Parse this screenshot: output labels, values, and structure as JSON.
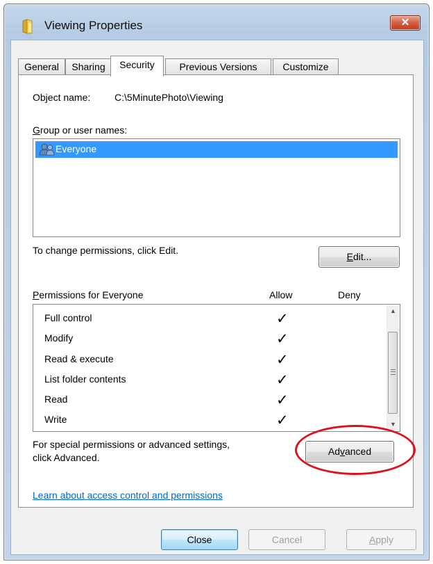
{
  "window": {
    "title": "Viewing Properties",
    "close_glyph": "✕"
  },
  "tabs": [
    {
      "label": "General",
      "active": false
    },
    {
      "label": "Sharing",
      "active": false
    },
    {
      "label": "Security",
      "active": true
    },
    {
      "label": "Previous Versions",
      "active": false
    },
    {
      "label": "Customize",
      "active": false
    }
  ],
  "security": {
    "object_name_label": "Object name:",
    "object_name_value": "C:\\5MinutePhoto\\Viewing",
    "group_label_prefix": "",
    "group_label_u": "G",
    "group_label_rest": "roup or user names:",
    "users": [
      {
        "name": "Everyone",
        "selected": true,
        "icon": "users-icon"
      }
    ],
    "change_hint": "To change permissions, click Edit.",
    "edit_u": "E",
    "edit_rest": "dit...",
    "permissions_u": "P",
    "permissions_rest": "ermissions for Everyone",
    "allow_header": "Allow",
    "deny_header": "Deny",
    "permissions": [
      {
        "name": "Full control",
        "allow": "✓",
        "deny": ""
      },
      {
        "name": "Modify",
        "allow": "✓",
        "deny": ""
      },
      {
        "name": "Read & execute",
        "allow": "✓",
        "deny": ""
      },
      {
        "name": "List folder contents",
        "allow": "✓",
        "deny": ""
      },
      {
        "name": "Read",
        "allow": "✓",
        "deny": ""
      },
      {
        "name": "Write",
        "allow": "✓",
        "deny": ""
      }
    ],
    "special_line1": "For special permissions or advanced settings,",
    "special_line2": "click Advanced.",
    "advanced_pre": "Ad",
    "advanced_u": "v",
    "advanced_post": "anced",
    "learn_link": "Learn about access control and permissions"
  },
  "footer": {
    "close_label": "Close",
    "cancel_label": "Cancel",
    "apply_u": "A",
    "apply_rest": "pply"
  },
  "colors": {
    "selection": "#3399ff",
    "link": "#0066cc",
    "annotation_circle": "#e0101a"
  }
}
